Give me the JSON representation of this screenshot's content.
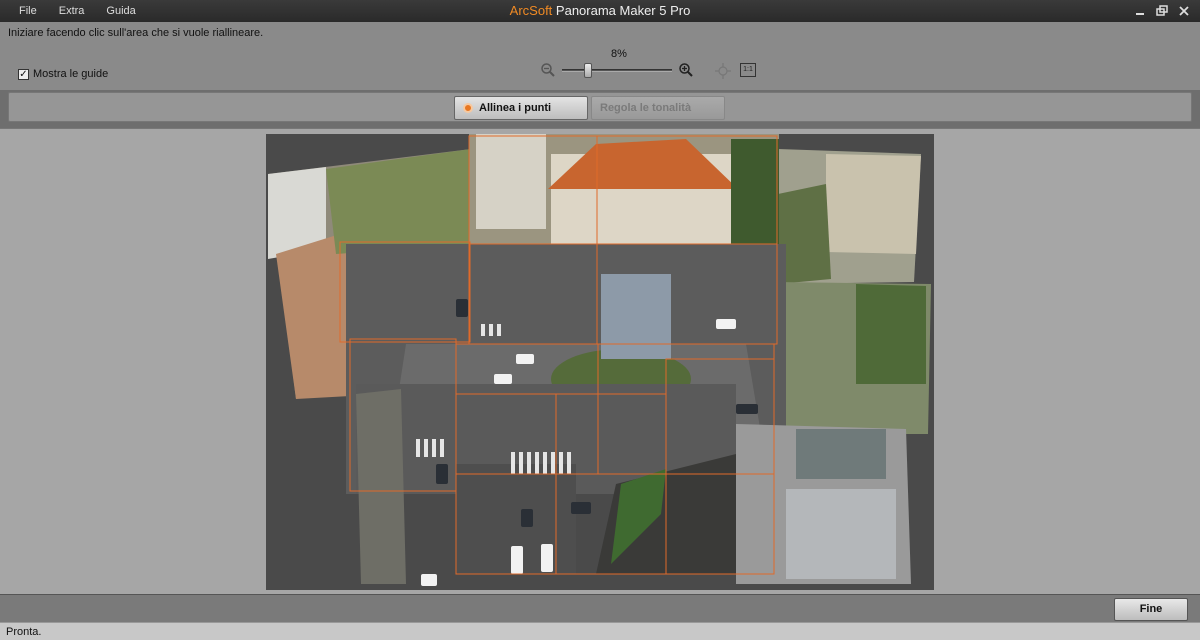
{
  "menu": {
    "items": [
      "File",
      "Extra",
      "Guida"
    ]
  },
  "window": {
    "brand": "ArcSoft",
    "title": "Panorama Maker 5 Pro"
  },
  "toolbar": {
    "instruction": "Iniziare facendo clic sull'area che si vuole riallineare.",
    "show_guides_label": "Mostra le guide",
    "show_guides_checked": true,
    "zoom_percent": "8%",
    "zoom_level": 0.08,
    "one_to_one_label": "1:1"
  },
  "tabs": [
    {
      "label": "Allinea i punti",
      "active": true
    },
    {
      "label": "Regola le tonalità",
      "active": false
    }
  ],
  "footer": {
    "finish_label": "Fine"
  },
  "status": {
    "text": "Pronta."
  },
  "colors": {
    "accent": "#e87722",
    "guide_lines": "#e06a2a"
  },
  "icons": [
    "zoom-out-icon",
    "zoom-in-icon",
    "fit-to-window-icon",
    "actual-size-icon",
    "minimize-icon",
    "restore-icon",
    "close-icon"
  ]
}
